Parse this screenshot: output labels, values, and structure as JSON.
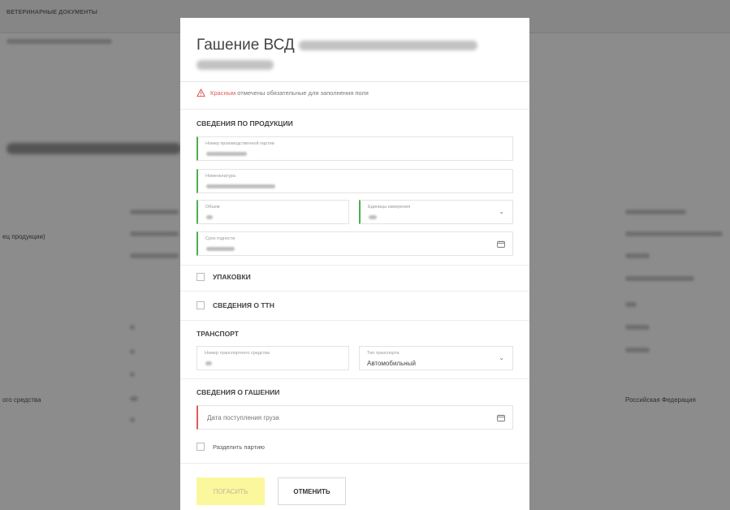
{
  "background": {
    "top_bar_title": "ВЕТЕРИНАРНЫЕ ДОКУМЕНТЫ",
    "left_labels": [
      "ец продукции)",
      "ого средства"
    ],
    "right_labels": [
      "Российская Федерация"
    ]
  },
  "modal": {
    "title": "Гашение ВСД",
    "warning": {
      "icon": "warning-triangle-icon",
      "highlight": "Красным",
      "text": "отмечены обязательные для заполнения поля"
    },
    "product_section": {
      "title": "СВЕДЕНИЯ ПО ПРОДУКЦИИ",
      "batch_label": "Номер производственной партии",
      "nomenclature_label": "Номенклатура",
      "volume_label": "Объем",
      "unit_label": "Единицы измерения",
      "expiry_label": "Срок годности"
    },
    "packaging_label": "УПАКОВКИ",
    "ttn_label": "СВЕДЕНИЯ О ТТН",
    "transport_section": {
      "title": "ТРАНСПОРТ",
      "vehicle_number_label": "Номер транспортного средства",
      "transport_type_label": "Тип транспорта",
      "transport_type_value": "Автомобильный"
    },
    "redemption_section": {
      "title": "СВЕДЕНИЯ О ГАШЕНИИ",
      "arrival_date_placeholder": "Дата поступления груза",
      "split_batch_label": "Разделить партию"
    },
    "buttons": {
      "submit": "ПОГАСИТЬ",
      "cancel": "ОТМЕНИТЬ"
    }
  },
  "colors": {
    "valid_border": "#4caf50",
    "required_border": "#e05a5a",
    "primary_button_bg": "#fbf79c",
    "overlay": "rgba(0,0,0,0.45)"
  }
}
